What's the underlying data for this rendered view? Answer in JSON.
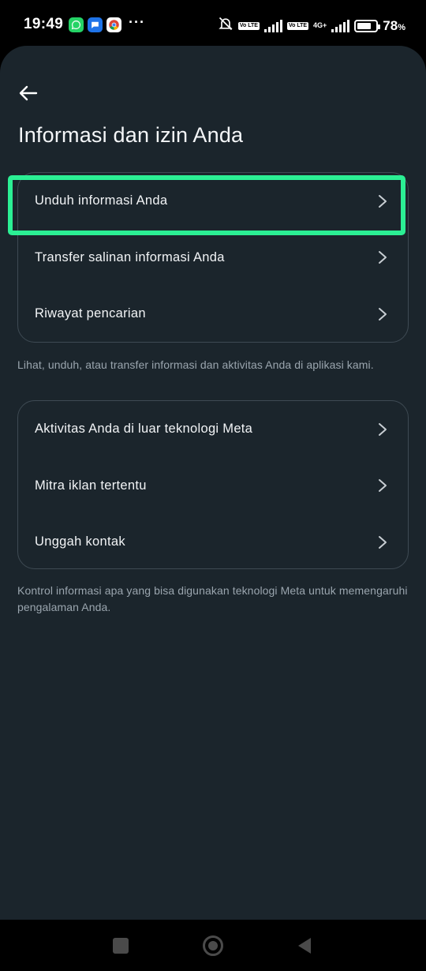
{
  "status_bar": {
    "time": "19:49",
    "more_indicator": "···",
    "volte_1": "Vo LTE",
    "volte_2": "Vo LTE",
    "network": "4G+",
    "battery_percent": "78",
    "battery_unit": "%",
    "battery_level": 0.78,
    "app_icons": [
      "whatsapp-icon",
      "messages-icon",
      "chrome-icon"
    ]
  },
  "header": {
    "title": "Informasi dan izin Anda"
  },
  "section_1": {
    "items": [
      {
        "label": "Unduh informasi Anda"
      },
      {
        "label": "Transfer salinan informasi Anda"
      },
      {
        "label": "Riwayat pencarian"
      }
    ],
    "helper_text": "Lihat, unduh, atau transfer informasi dan aktivitas Anda di aplikasi kami."
  },
  "section_2": {
    "items": [
      {
        "label": "Aktivitas Anda di luar teknologi Meta"
      },
      {
        "label": "Mitra iklan tertentu"
      },
      {
        "label": "Unggah kontak"
      }
    ],
    "helper_text": "Kontrol informasi apa yang bisa digunakan teknologi Meta untuk memengaruhi pengalaman Anda."
  },
  "colors": {
    "background": "#1b252c",
    "card_border": "#3e4a53",
    "highlight": "#2bef94",
    "text_primary": "#f2f4f6",
    "text_secondary": "#9aa5ae"
  }
}
